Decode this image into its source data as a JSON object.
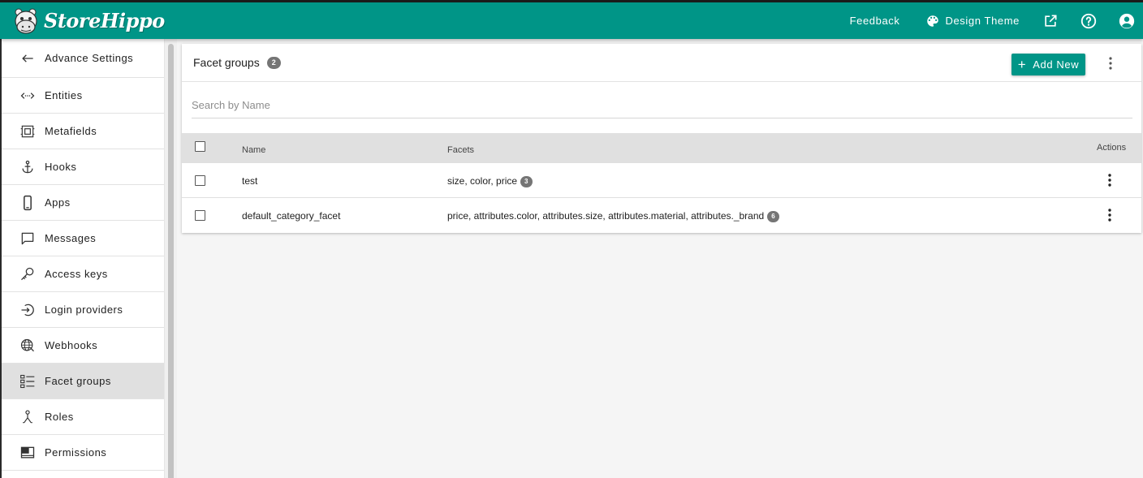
{
  "app": {
    "brand": "StoreHippo",
    "accent_color": "#009587"
  },
  "topbar": {
    "feedback_label": "Feedback",
    "design_theme_label": "Design Theme",
    "icons": [
      "palette-icon",
      "open-external-icon",
      "help-icon",
      "account-icon"
    ]
  },
  "sidebar": {
    "back_label": "Advance Settings",
    "items": [
      {
        "label": "Entities",
        "icon": "code-arrows-icon"
      },
      {
        "label": "Metafields",
        "icon": "metafields-icon"
      },
      {
        "label": "Hooks",
        "icon": "anchor-icon"
      },
      {
        "label": "Apps",
        "icon": "phone-icon"
      },
      {
        "label": "Messages",
        "icon": "message-icon"
      },
      {
        "label": "Access keys",
        "icon": "key-icon"
      },
      {
        "label": "Login providers",
        "icon": "login-icon"
      },
      {
        "label": "Webhooks",
        "icon": "globe-icon"
      },
      {
        "label": "Facet groups",
        "icon": "facet-list-icon",
        "active": true
      },
      {
        "label": "Roles",
        "icon": "roles-icon"
      },
      {
        "label": "Permissions",
        "icon": "permissions-icon"
      }
    ]
  },
  "page": {
    "title": "Facet groups",
    "count": "2",
    "add_new_label": "Add New",
    "search_placeholder": "Search by Name"
  },
  "table": {
    "columns": {
      "name": "Name",
      "facets": "Facets",
      "actions": "Actions"
    },
    "rows": [
      {
        "name": "test",
        "facets": "size, color, price",
        "facet_count": "3"
      },
      {
        "name": "default_category_facet",
        "facets": "price, attributes.color, attributes.size, attributes.material, attributes._brand",
        "facet_count": "6"
      }
    ]
  }
}
